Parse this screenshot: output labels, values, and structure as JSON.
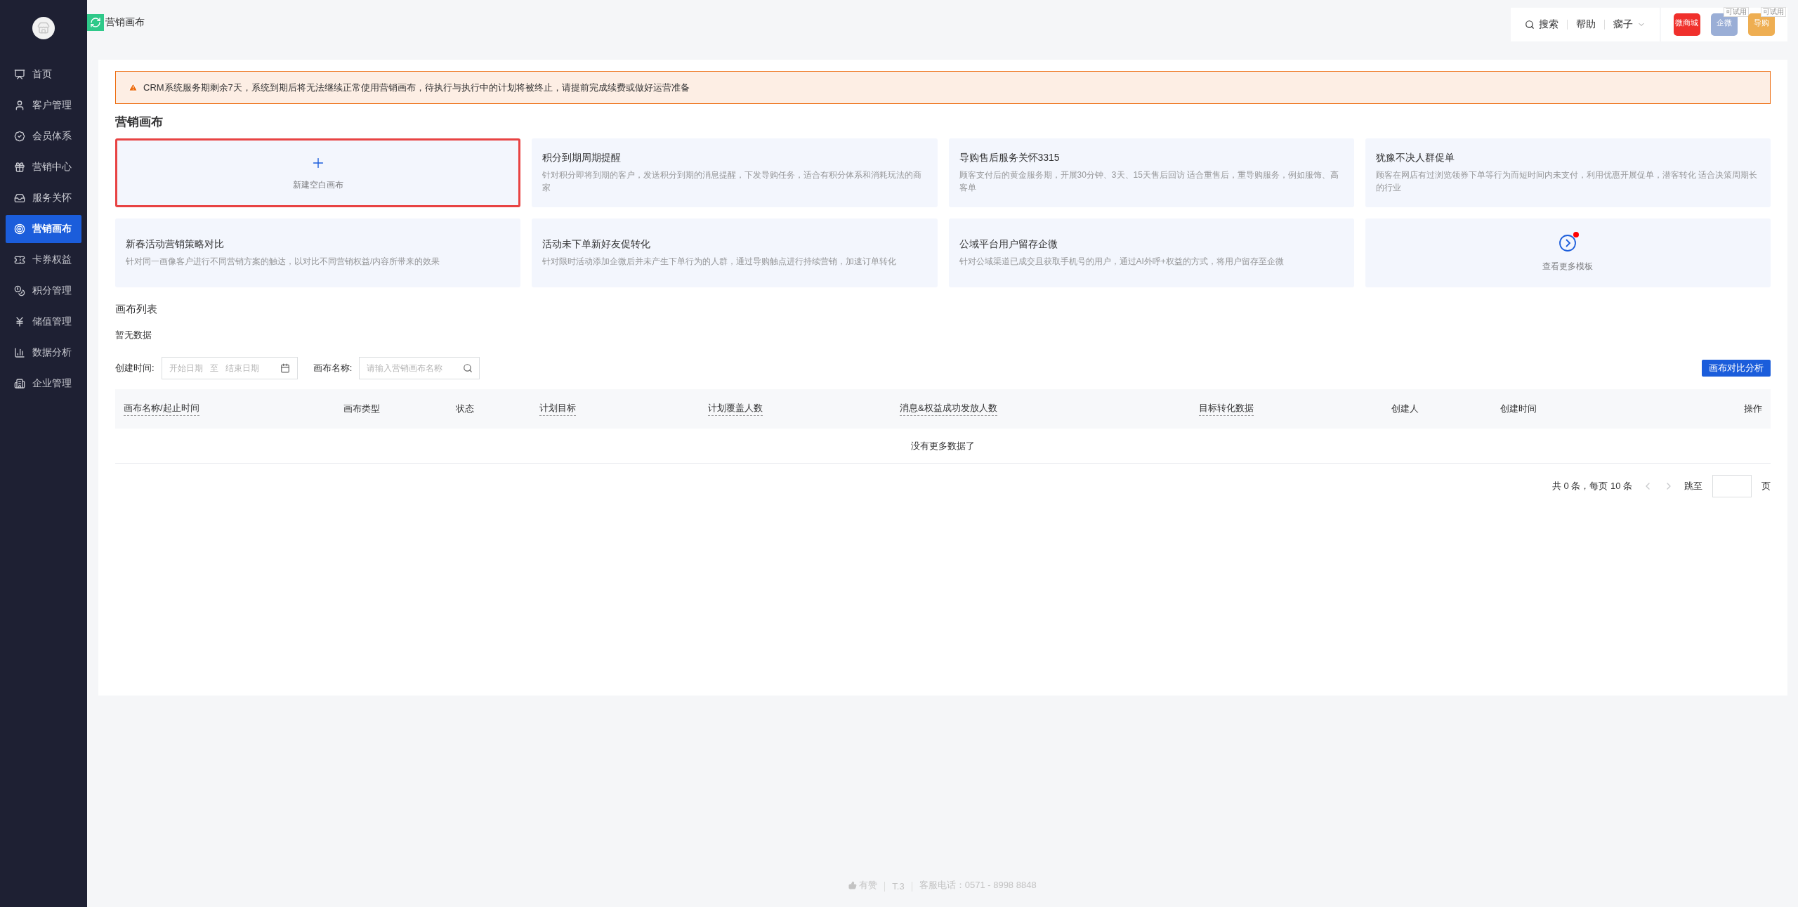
{
  "sidebar": {
    "items": [
      {
        "label": "首页",
        "selected": false
      },
      {
        "label": "客户管理",
        "selected": false
      },
      {
        "label": "会员体系",
        "selected": false
      },
      {
        "label": "营销中心",
        "selected": false
      },
      {
        "label": "服务关怀",
        "selected": false
      },
      {
        "label": "营销画布",
        "selected": true
      },
      {
        "label": "卡券权益",
        "selected": false
      },
      {
        "label": "积分管理",
        "selected": false
      },
      {
        "label": "储值管理",
        "selected": false
      },
      {
        "label": "数据分析",
        "selected": false
      },
      {
        "label": "企业管理",
        "selected": false
      }
    ]
  },
  "header": {
    "title": "营销画布",
    "search": "搜索",
    "help": "帮助",
    "user": "瘸子",
    "apps": [
      {
        "label": "微商城",
        "color": "#f0302c"
      },
      {
        "label": "企微",
        "color": "#9aaed6",
        "badge": "可试用"
      },
      {
        "label": "导购",
        "color": "#eeae52",
        "badge": "可试用"
      }
    ]
  },
  "notice": "CRM系统服务期剩余7天，系统到期后将无法继续正常使用营销画布，待执行与执行中的计划将被终止，请提前完成续费或做好运营准备",
  "templates": {
    "title": "营销画布",
    "cards": [
      {
        "kind": "new",
        "label": "新建空白画布",
        "highlighted": true
      },
      {
        "kind": "template",
        "title": "积分到期周期提醒",
        "desc": "针对积分即将到期的客户，发送积分到期的消息提醒，下发导购任务，适合有积分体系和消耗玩法的商家"
      },
      {
        "kind": "template",
        "title": "导购售后服务关怀3315",
        "desc": "顾客支付后的黄金服务期，开展30分钟、3天、15天售后回访 适合重售后，重导购服务，例如服饰、高客单"
      },
      {
        "kind": "template",
        "title": "犹豫不决人群促单",
        "desc": "顾客在网店有过浏览领券下单等行为而短时间内未支付，利用优惠开展促单，潜客转化 适合决策周期长的行业"
      },
      {
        "kind": "template",
        "title": "新春活动营销策略对比",
        "desc": "针对同一画像客户进行不同营销方案的触达，以对比不同营销权益/内容所带来的效果"
      },
      {
        "kind": "template",
        "title": "活动未下单新好友促转化",
        "desc": "针对限时活动添加企微后并未产生下单行为的人群，通过导购触点进行持续营销，加速订单转化"
      },
      {
        "kind": "template",
        "title": "公域平台用户留存企微",
        "desc": "针对公域渠道已成交且获取手机号的用户，通过AI外呼+权益的方式，将用户留存至企微"
      },
      {
        "kind": "more",
        "label": "查看更多模板"
      }
    ]
  },
  "list": {
    "title": "画布列表",
    "empty": "暂无数据",
    "filters": {
      "date_label": "创建时间:",
      "start": "开始日期",
      "sep": "至",
      "end": "结束日期",
      "name_label": "画布名称:",
      "name_placeholder": "请输入营销画布名称"
    },
    "compare_button": "画布对比分析",
    "columns": [
      {
        "label": "画布名称/起止时间",
        "dashed": true
      },
      {
        "label": "画布类型",
        "dashed": false
      },
      {
        "label": "状态",
        "dashed": false
      },
      {
        "label": "计划目标",
        "dashed": true
      },
      {
        "label": "计划覆盖人数",
        "dashed": true
      },
      {
        "label": "消息&权益成功发放人数",
        "dashed": true
      },
      {
        "label": "目标转化数据",
        "dashed": true
      },
      {
        "label": "创建人",
        "dashed": false
      },
      {
        "label": "创建时间",
        "dashed": false
      },
      {
        "label": "操作",
        "dashed": false
      }
    ],
    "no_more": "没有更多数据了",
    "pagination": {
      "summary": "共 0 条，每页 10 条",
      "jump": "跳至",
      "page": "页"
    }
  },
  "footer": {
    "brand": "有赞",
    "version": "T.3",
    "phone": "客服电话：0571 - 8998 8848"
  }
}
